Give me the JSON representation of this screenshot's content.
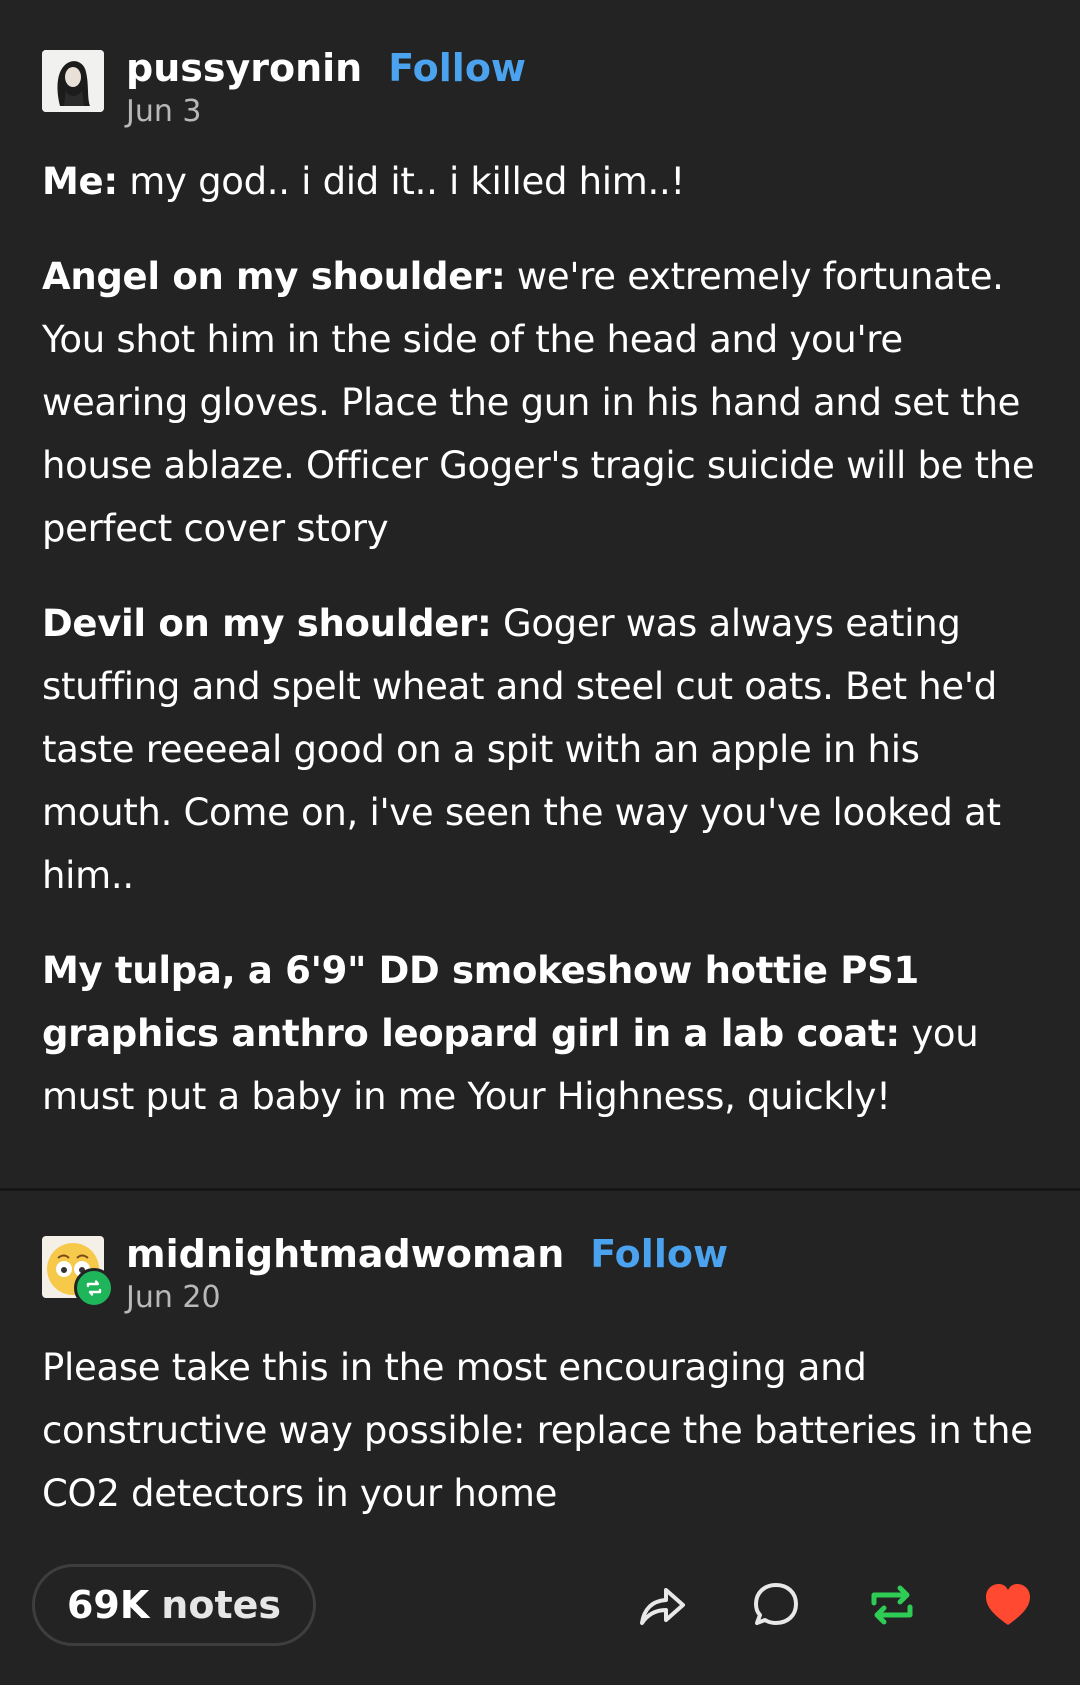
{
  "post": {
    "author": "pussyronin",
    "follow_label": "Follow",
    "date": "Jun 3",
    "lines": [
      {
        "label": "Me:",
        "text": " my god.. i did it.. i killed him..!"
      },
      {
        "label": "Angel on my shoulder:",
        "text": " we're extremely fortunate. You shot him in the side of the head and you're wearing gloves. Place the gun in his hand and set the house ablaze. Officer Goger's tragic suicide will be the perfect cover story"
      },
      {
        "label": "Devil on my shoulder:",
        "text": " Goger was always eating stuffing and spelt wheat and steel cut oats. Bet he'd taste reeeeal good on a spit with an apple in his mouth. Come on, i've seen the way you've looked at him.."
      },
      {
        "label": "My tulpa, a 6'9\" DD smokeshow hottie PS1 graphics anthro leopard girl in a lab coat:",
        "text": " you must put a baby in me Your Highness, quickly!"
      }
    ]
  },
  "reply": {
    "author": "midnightmadwoman",
    "follow_label": "Follow",
    "date": "Jun 20",
    "text": "Please take this in the most encouraging and constructive way possible: replace the batteries in the CO2 detectors in your home"
  },
  "footer": {
    "notes_count": "69K",
    "notes_label": "notes",
    "icons": [
      "share-icon",
      "comment-icon",
      "reblog-icon",
      "like-icon"
    ],
    "colors": {
      "reblog": "#2ecc55",
      "like": "#ff4930",
      "follow": "#4ba2ee"
    }
  }
}
